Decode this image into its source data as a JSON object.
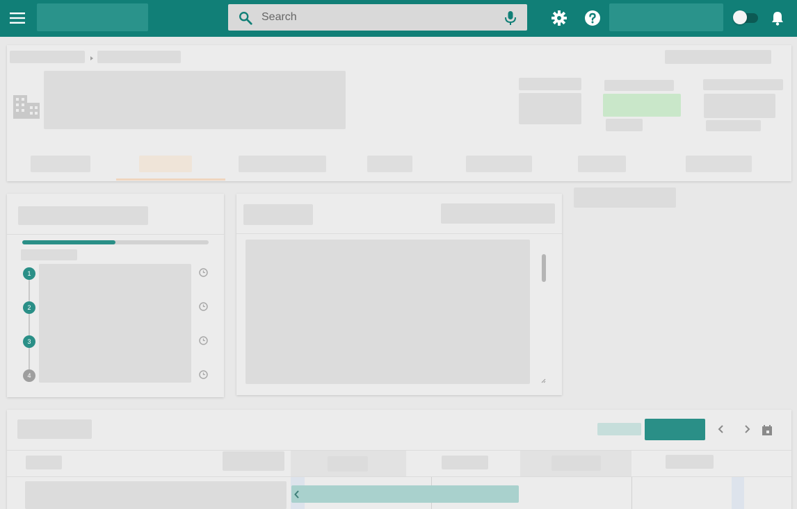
{
  "topbar": {
    "background": "#117f77",
    "menu_icon": "menu-icon",
    "search": {
      "placeholder": "Search",
      "value": "",
      "icon": "search-icon",
      "mic_icon": "mic-icon"
    },
    "settings_icon": "gear-icon",
    "help_icon": "help-icon",
    "theme_toggle": {
      "state": "off"
    },
    "notifications_icon": "bell-icon"
  },
  "steps": {
    "progress": 0.5,
    "items": [
      {
        "number": "1",
        "status": "done"
      },
      {
        "number": "2",
        "status": "done"
      },
      {
        "number": "3",
        "status": "done"
      },
      {
        "number": "4",
        "status": "pending"
      }
    ]
  },
  "colors": {
    "accent": "#2a8f87",
    "tab_active": "#efd5bf",
    "success": "#c9e7c9"
  }
}
